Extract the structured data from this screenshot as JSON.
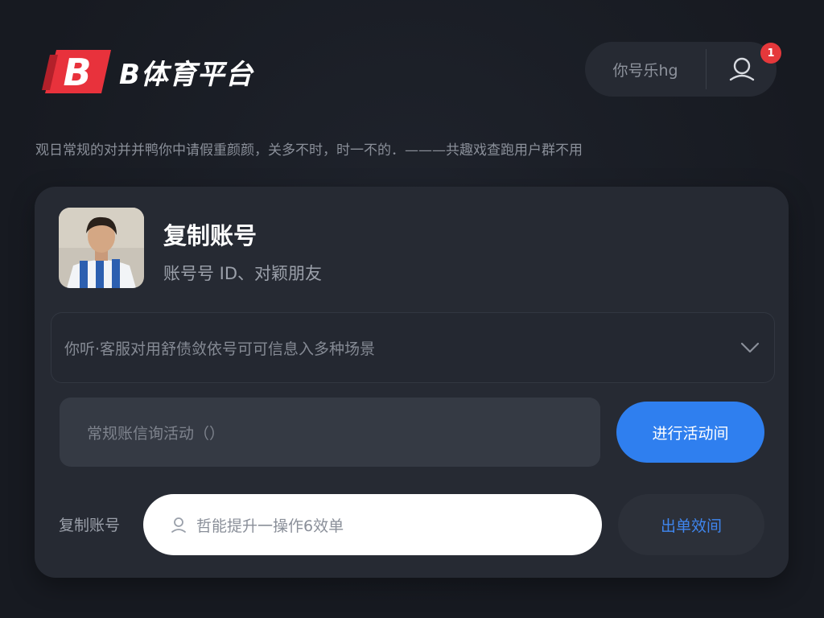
{
  "header": {
    "brand": "B体育平台",
    "logo_letter": "B",
    "user_label": "你号乐hg",
    "notification_count": "1"
  },
  "notice": "观日常规的对并并鸭你中请假重颜颜，关多不时，时一不的．———共趣戏查跑用户群不用",
  "profile": {
    "title": "复制账号",
    "subtitle": "账号号 ID、对颖朋友"
  },
  "dropdown": {
    "selected": "你听·客服对用舒债敛依号可可信息入多种场景"
  },
  "activity_input": {
    "placeholder": "常规账信询活动（）"
  },
  "primary_button": {
    "label": "进行活动间"
  },
  "copy_row": {
    "label": "复制账号",
    "placeholder": "哲能提升一操作6效单"
  },
  "secondary_button": {
    "label": "出单效间"
  },
  "colors": {
    "background": "#171a21",
    "card": "#262a33",
    "accent_blue": "#2f7fef",
    "logo_red": "#e8323c",
    "badge_red": "#e5383b"
  },
  "icons": [
    "logo-mark",
    "user-avatar-icon",
    "chevron-down-icon",
    "lock-icon"
  ]
}
